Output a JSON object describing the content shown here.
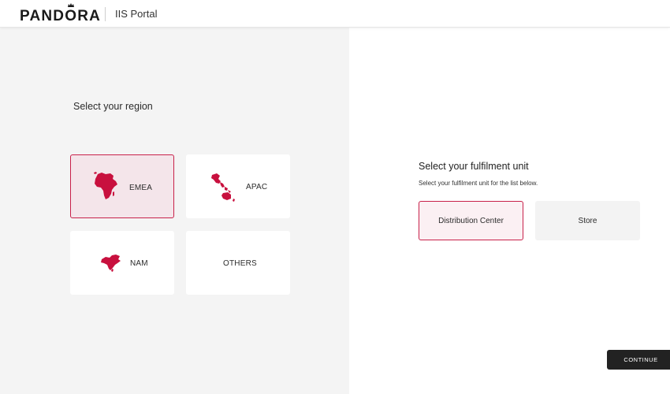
{
  "header": {
    "brand": "PANDORA",
    "brand_prefix": "PAND",
    "brand_o": "O",
    "brand_suffix": "RA",
    "portal_title": "IIS Portal"
  },
  "region": {
    "heading": "Select your region",
    "options": [
      {
        "label": "EMEA",
        "icon": "africa-map-icon",
        "selected": true
      },
      {
        "label": "APAC",
        "icon": "asia-pacific-map-icon",
        "selected": false
      },
      {
        "label": "NAM",
        "icon": "north-america-map-icon",
        "selected": false
      },
      {
        "label": "OTHERS",
        "icon": "",
        "selected": false
      }
    ]
  },
  "fulfilment": {
    "heading": "Select your fulfilment unit",
    "subheading": "Select your fulfilment unit for the list below.",
    "options": [
      {
        "label": "Distribution Center",
        "selected": true
      },
      {
        "label": "Store",
        "selected": false
      }
    ]
  },
  "actions": {
    "continue_label": "CONTINUE"
  },
  "colors": {
    "accent": "#c8214a",
    "map_fill": "#c8103e",
    "selected_bg": "#f4e5ea",
    "left_panel_bg": "#f4f4f4",
    "button_bg": "#222222"
  }
}
